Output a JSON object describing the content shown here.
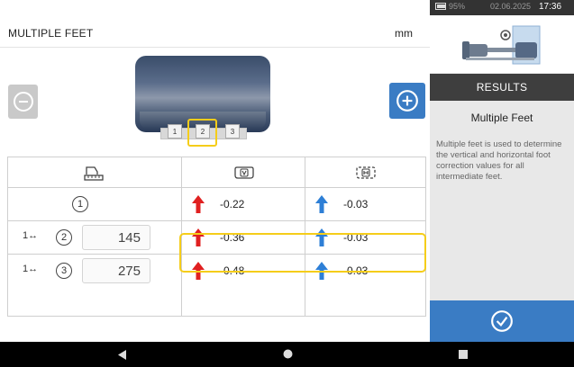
{
  "header": {
    "title": "MULTIPLE FEET",
    "unit": "mm"
  },
  "feet_selector": {
    "feet": [
      "1",
      "2",
      "3"
    ],
    "selected": "2"
  },
  "table": {
    "columns": [
      {
        "icon": "distance-ruler-icon"
      },
      {
        "icon": "vertical-view-icon"
      },
      {
        "icon": "horizontal-view-icon"
      }
    ],
    "rows": [
      {
        "foot": "1",
        "prefix": "",
        "distance": "",
        "vertical": "-0.22",
        "horizontal": "-0.03"
      },
      {
        "foot": "2",
        "prefix": "1↔",
        "distance": "145",
        "vertical": "-0.36",
        "horizontal": "-0.03"
      },
      {
        "foot": "3",
        "prefix": "1↔",
        "distance": "275",
        "vertical": "-0.48",
        "horizontal": "-0.03"
      }
    ],
    "highlighted_row": "2",
    "colors": {
      "vertical_arrow": "#e02020",
      "horizontal_arrow": "#2e7fd6",
      "highlight": "#f5cd1a"
    }
  },
  "status_bar": {
    "battery": "95%",
    "date": "02.06.2025",
    "time": "17:36"
  },
  "right_panel": {
    "section": "RESULTS",
    "title": "Multiple Feet",
    "description": "Multiple feet is used to determine the vertical and horizontal foot correction values for all intermediate feet."
  },
  "colors": {
    "accent": "#3a7cc4",
    "panel_bg": "#e8e8e8",
    "dark_bar": "#3e3e3e"
  }
}
